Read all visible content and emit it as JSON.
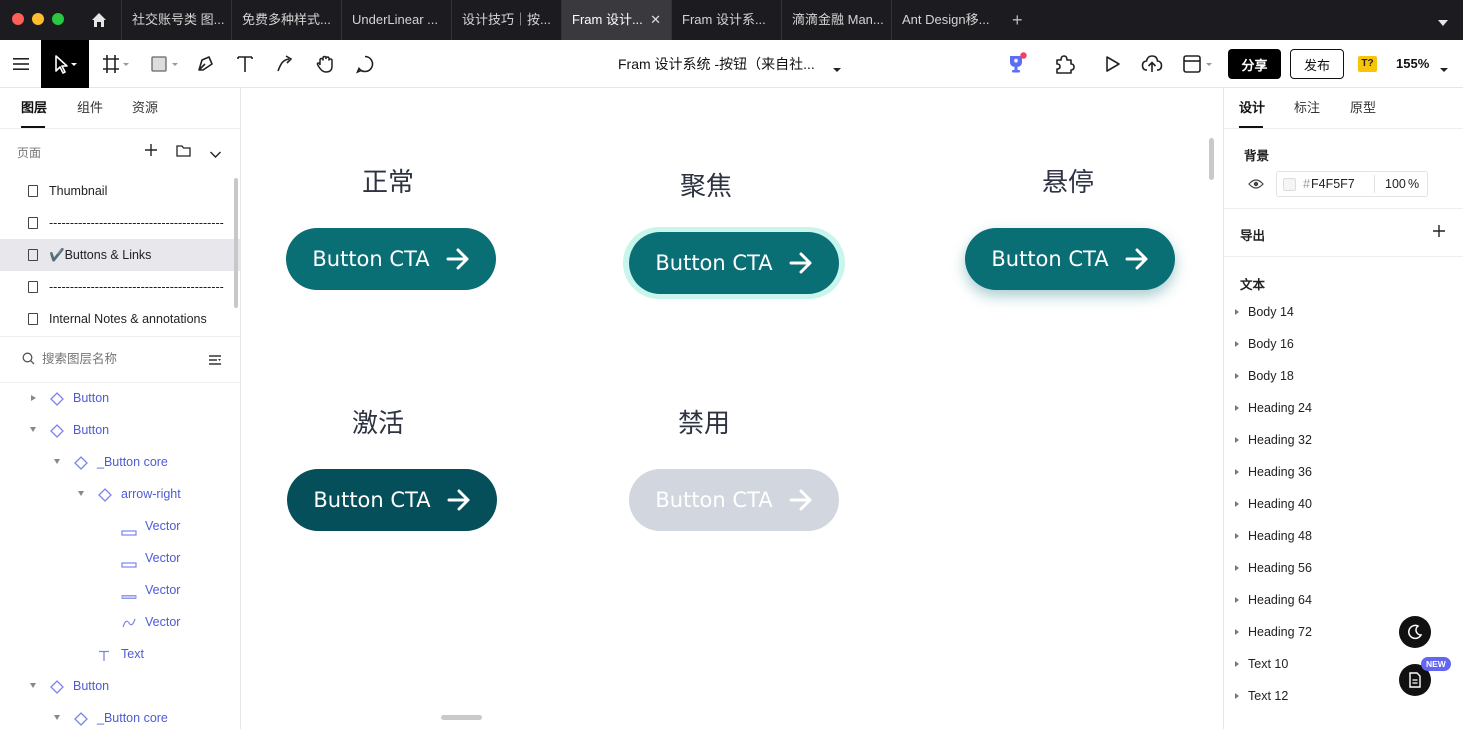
{
  "tabs": [
    {
      "label": "社交账号类 图..."
    },
    {
      "label": "免费多种样式..."
    },
    {
      "label": "UnderLinear ..."
    },
    {
      "label": "设计技巧｜按..."
    },
    {
      "label": "Fram 设计..."
    },
    {
      "label": "Fram 设计系..."
    },
    {
      "label": "滴滴金融 Man..."
    },
    {
      "label": "Ant Design移..."
    }
  ],
  "toolbar": {
    "doc_title": "Fram 设计系统 -按钮（来自社...",
    "share_label": "分享",
    "publish_label": "发布",
    "badge_label": "T?",
    "zoom": "155%"
  },
  "left": {
    "tabs": [
      "图层",
      "组件",
      "资源"
    ],
    "pages_label": "页面",
    "pages": [
      {
        "label": "Thumbnail"
      },
      {
        "label": "------------------------------------------"
      },
      {
        "label": "✔️Buttons & Links"
      },
      {
        "label": "------------------------------------------"
      },
      {
        "label": "Internal Notes & annotations"
      }
    ],
    "search_placeholder": "搜索图层名称",
    "layers": [
      {
        "label": "Button"
      },
      {
        "label": "Button"
      },
      {
        "label": "_Button core"
      },
      {
        "label": "arrow-right"
      },
      {
        "label": "Vector"
      },
      {
        "label": "Vector"
      },
      {
        "label": "Vector"
      },
      {
        "label": "Vector"
      },
      {
        "label": "Text"
      },
      {
        "label": "Button"
      },
      {
        "label": "_Button core"
      }
    ]
  },
  "canvas": {
    "states": [
      {
        "label": "正常",
        "button": "Button CTA",
        "color": "#0a6e75"
      },
      {
        "label": "聚焦",
        "button": "Button CTA",
        "color": "#0a6e75"
      },
      {
        "label": "悬停",
        "button": "Button CTA",
        "color": "#0a6e75"
      },
      {
        "label": "激活",
        "button": "Button CTA",
        "color": "#044f5a"
      },
      {
        "label": "禁用",
        "button": "Button CTA",
        "color": "#d2d6de"
      }
    ],
    "focus_ring_color": "#c8f5ec"
  },
  "right": {
    "tabs": [
      "设计",
      "标注",
      "原型"
    ],
    "background_label": "背景",
    "bg_hex": "F4F5F7",
    "bg_hash": "#",
    "bg_opacity": "100",
    "bg_opacity_unit": "%",
    "export_label": "导出",
    "text_label": "文本",
    "text_styles": [
      "Body 14",
      "Body 16",
      "Body 18",
      "Heading 24",
      "Heading 32",
      "Heading 36",
      "Heading 40",
      "Heading 48",
      "Heading 56",
      "Heading 64",
      "Heading 72",
      "Text 10",
      "Text 12"
    ],
    "new_badge": "NEW"
  }
}
